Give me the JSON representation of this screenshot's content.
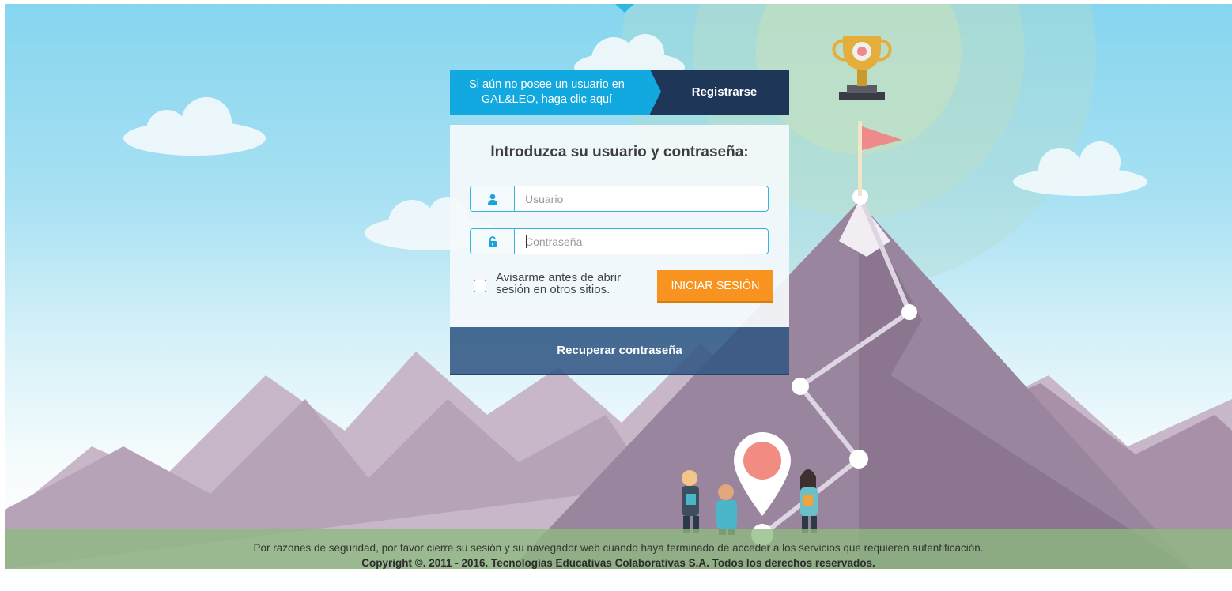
{
  "register": {
    "prompt_line1": "Si aún no posee un usuario en",
    "prompt_line2": "GAL&LEO, haga clic aquí",
    "button_label": "Registrarse"
  },
  "login": {
    "title": "Introduzca su usuario y contraseña:",
    "username_placeholder": "Usuario",
    "password_placeholder": "Contraseña",
    "remember_line1": "Avisarme antes de abrir",
    "remember_line2": "sesión en otros sitios.",
    "remember_checked": false,
    "submit_label": "INICIAR SESIÓN"
  },
  "recover": {
    "label": "Recuperar contraseña"
  },
  "footer": {
    "security_notice": "Por razones de seguridad, por favor cierre su sesión y su navegador web cuando haya terminado de acceder a los servicios que requieren autentificación.",
    "copyright": "Copyright ©. 2011 - 2016. Tecnologías Educativas Colaborativas S.A. Todos los derechos reservados."
  },
  "icons": {
    "username": "user-icon",
    "password": "lock-icon"
  },
  "colors": {
    "register_prompt_bg": "#11a9df",
    "register_button_bg": "#1e3657",
    "input_border": "#34b5dd",
    "login_button_bg": "#f7931e",
    "recover_button_bg": "#315683",
    "footer_bg": "#8eba80"
  }
}
